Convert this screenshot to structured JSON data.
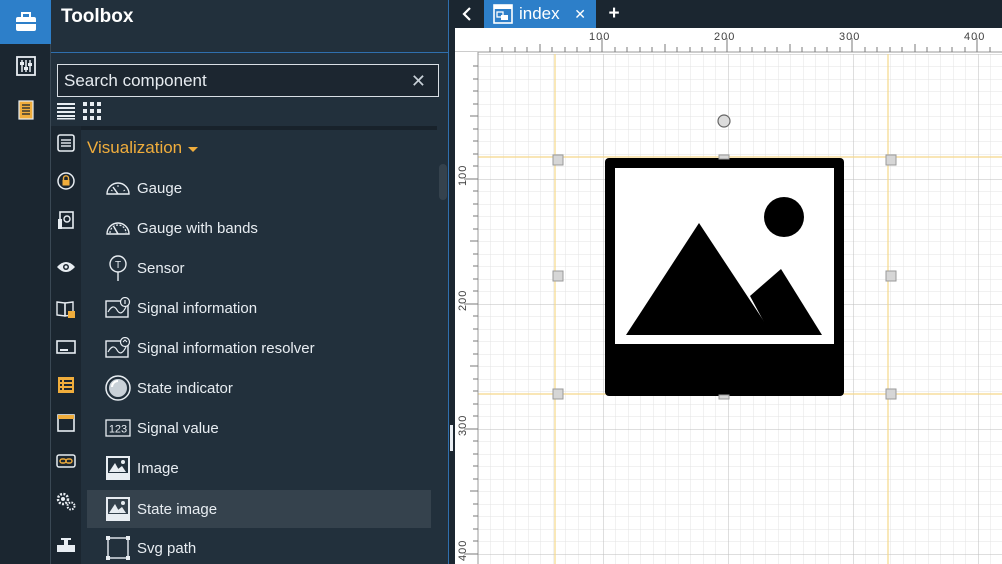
{
  "toolbox": {
    "title": "Toolbox",
    "search_placeholder": "Search component",
    "search_clear": "✕"
  },
  "category": {
    "name": "Visualization",
    "items": [
      {
        "label": "Gauge",
        "icon": "gauge-icon"
      },
      {
        "label": "Gauge with bands",
        "icon": "gauge-bands-icon"
      },
      {
        "label": "Sensor",
        "icon": "sensor-icon"
      },
      {
        "label": "Signal information",
        "icon": "signal-information-icon"
      },
      {
        "label": "Signal information resolver",
        "icon": "signal-resolver-icon"
      },
      {
        "label": "State indicator",
        "icon": "state-indicator-icon"
      },
      {
        "label": "Signal value",
        "icon": "signal-value-icon"
      },
      {
        "label": "Image",
        "icon": "image-icon"
      },
      {
        "label": "State image",
        "icon": "state-image-icon",
        "selected": true
      },
      {
        "label": "Svg path",
        "icon": "svg-path-icon"
      }
    ]
  },
  "tabs": {
    "back": "‹",
    "active": {
      "label": "index",
      "close": "✕"
    },
    "add": "+"
  },
  "rulers": {
    "horizontal_ticks": [
      "100",
      "200",
      "300",
      "400"
    ],
    "vertical_ticks": [
      "100",
      "200",
      "300",
      "400"
    ]
  },
  "colors": {
    "accent": "#2d7fc9",
    "category": "#f0ad3c",
    "panel": "#22303c",
    "guide": "#f5d88a"
  }
}
